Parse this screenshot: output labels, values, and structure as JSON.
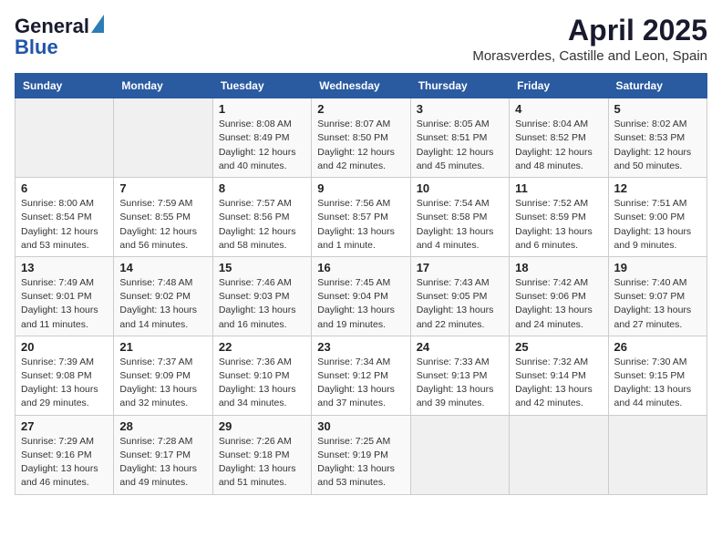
{
  "header": {
    "logo_general": "General",
    "logo_blue": "Blue",
    "month": "April 2025",
    "location": "Morasverdes, Castille and Leon, Spain"
  },
  "weekdays": [
    "Sunday",
    "Monday",
    "Tuesday",
    "Wednesday",
    "Thursday",
    "Friday",
    "Saturday"
  ],
  "weeks": [
    [
      {
        "day": "",
        "info": ""
      },
      {
        "day": "",
        "info": ""
      },
      {
        "day": "1",
        "info": "Sunrise: 8:08 AM\nSunset: 8:49 PM\nDaylight: 12 hours and 40 minutes."
      },
      {
        "day": "2",
        "info": "Sunrise: 8:07 AM\nSunset: 8:50 PM\nDaylight: 12 hours and 42 minutes."
      },
      {
        "day": "3",
        "info": "Sunrise: 8:05 AM\nSunset: 8:51 PM\nDaylight: 12 hours and 45 minutes."
      },
      {
        "day": "4",
        "info": "Sunrise: 8:04 AM\nSunset: 8:52 PM\nDaylight: 12 hours and 48 minutes."
      },
      {
        "day": "5",
        "info": "Sunrise: 8:02 AM\nSunset: 8:53 PM\nDaylight: 12 hours and 50 minutes."
      }
    ],
    [
      {
        "day": "6",
        "info": "Sunrise: 8:00 AM\nSunset: 8:54 PM\nDaylight: 12 hours and 53 minutes."
      },
      {
        "day": "7",
        "info": "Sunrise: 7:59 AM\nSunset: 8:55 PM\nDaylight: 12 hours and 56 minutes."
      },
      {
        "day": "8",
        "info": "Sunrise: 7:57 AM\nSunset: 8:56 PM\nDaylight: 12 hours and 58 minutes."
      },
      {
        "day": "9",
        "info": "Sunrise: 7:56 AM\nSunset: 8:57 PM\nDaylight: 13 hours and 1 minute."
      },
      {
        "day": "10",
        "info": "Sunrise: 7:54 AM\nSunset: 8:58 PM\nDaylight: 13 hours and 4 minutes."
      },
      {
        "day": "11",
        "info": "Sunrise: 7:52 AM\nSunset: 8:59 PM\nDaylight: 13 hours and 6 minutes."
      },
      {
        "day": "12",
        "info": "Sunrise: 7:51 AM\nSunset: 9:00 PM\nDaylight: 13 hours and 9 minutes."
      }
    ],
    [
      {
        "day": "13",
        "info": "Sunrise: 7:49 AM\nSunset: 9:01 PM\nDaylight: 13 hours and 11 minutes."
      },
      {
        "day": "14",
        "info": "Sunrise: 7:48 AM\nSunset: 9:02 PM\nDaylight: 13 hours and 14 minutes."
      },
      {
        "day": "15",
        "info": "Sunrise: 7:46 AM\nSunset: 9:03 PM\nDaylight: 13 hours and 16 minutes."
      },
      {
        "day": "16",
        "info": "Sunrise: 7:45 AM\nSunset: 9:04 PM\nDaylight: 13 hours and 19 minutes."
      },
      {
        "day": "17",
        "info": "Sunrise: 7:43 AM\nSunset: 9:05 PM\nDaylight: 13 hours and 22 minutes."
      },
      {
        "day": "18",
        "info": "Sunrise: 7:42 AM\nSunset: 9:06 PM\nDaylight: 13 hours and 24 minutes."
      },
      {
        "day": "19",
        "info": "Sunrise: 7:40 AM\nSunset: 9:07 PM\nDaylight: 13 hours and 27 minutes."
      }
    ],
    [
      {
        "day": "20",
        "info": "Sunrise: 7:39 AM\nSunset: 9:08 PM\nDaylight: 13 hours and 29 minutes."
      },
      {
        "day": "21",
        "info": "Sunrise: 7:37 AM\nSunset: 9:09 PM\nDaylight: 13 hours and 32 minutes."
      },
      {
        "day": "22",
        "info": "Sunrise: 7:36 AM\nSunset: 9:10 PM\nDaylight: 13 hours and 34 minutes."
      },
      {
        "day": "23",
        "info": "Sunrise: 7:34 AM\nSunset: 9:12 PM\nDaylight: 13 hours and 37 minutes."
      },
      {
        "day": "24",
        "info": "Sunrise: 7:33 AM\nSunset: 9:13 PM\nDaylight: 13 hours and 39 minutes."
      },
      {
        "day": "25",
        "info": "Sunrise: 7:32 AM\nSunset: 9:14 PM\nDaylight: 13 hours and 42 minutes."
      },
      {
        "day": "26",
        "info": "Sunrise: 7:30 AM\nSunset: 9:15 PM\nDaylight: 13 hours and 44 minutes."
      }
    ],
    [
      {
        "day": "27",
        "info": "Sunrise: 7:29 AM\nSunset: 9:16 PM\nDaylight: 13 hours and 46 minutes."
      },
      {
        "day": "28",
        "info": "Sunrise: 7:28 AM\nSunset: 9:17 PM\nDaylight: 13 hours and 49 minutes."
      },
      {
        "day": "29",
        "info": "Sunrise: 7:26 AM\nSunset: 9:18 PM\nDaylight: 13 hours and 51 minutes."
      },
      {
        "day": "30",
        "info": "Sunrise: 7:25 AM\nSunset: 9:19 PM\nDaylight: 13 hours and 53 minutes."
      },
      {
        "day": "",
        "info": ""
      },
      {
        "day": "",
        "info": ""
      },
      {
        "day": "",
        "info": ""
      }
    ]
  ]
}
